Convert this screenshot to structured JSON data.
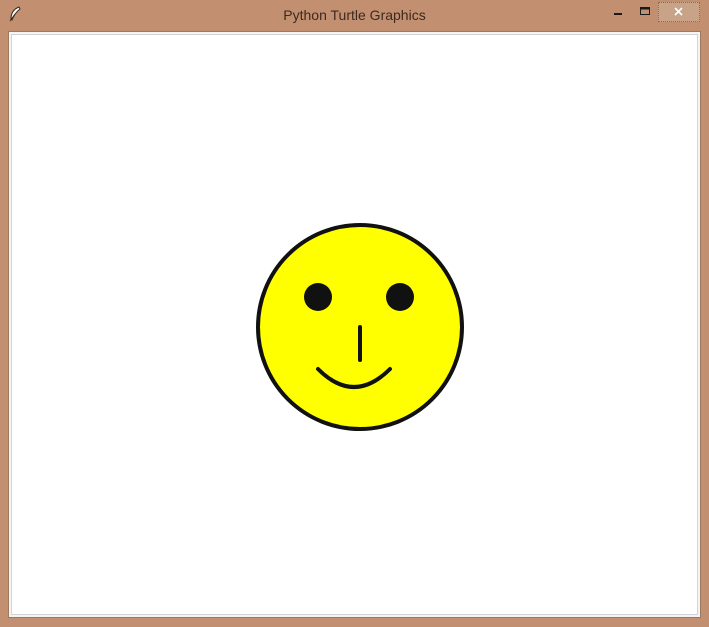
{
  "window": {
    "title": "Python Turtle Graphics",
    "frame_color": "#c29070",
    "icons": {
      "app": "feather-icon",
      "minimize": "minimize-icon",
      "maximize": "maximize-icon",
      "close": "close-icon"
    }
  },
  "canvas": {
    "background": "#ffffff",
    "drawing": {
      "subject": "smiley-face",
      "face_fill": "#ffff00",
      "outline_color": "#111111",
      "eye_color": "#111111"
    }
  }
}
